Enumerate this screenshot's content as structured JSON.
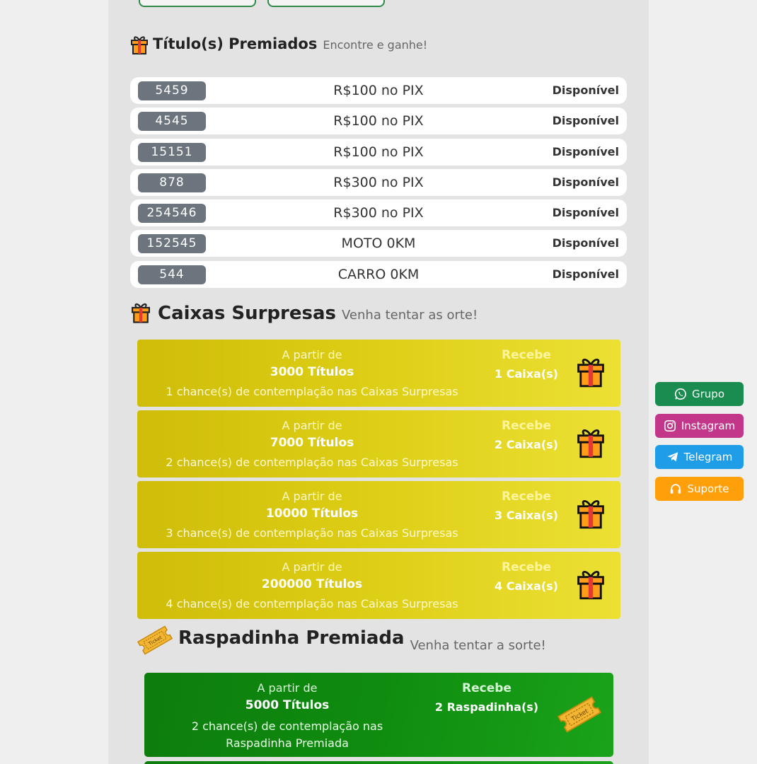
{
  "premiados": {
    "title": "Título(s) Premiados",
    "subtitle": "Encontre e ganhe!",
    "rows": [
      {
        "number": "5459",
        "prize": "R$100 no PIX",
        "status": "Disponível"
      },
      {
        "number": "4545",
        "prize": "R$100 no PIX",
        "status": "Disponível"
      },
      {
        "number": "15151",
        "prize": "R$100 no PIX",
        "status": "Disponível"
      },
      {
        "number": "878",
        "prize": "R$300 no PIX",
        "status": "Disponível"
      },
      {
        "number": "254546",
        "prize": "R$300 no PIX",
        "status": "Disponível"
      },
      {
        "number": "152545",
        "prize": "MOTO 0KM",
        "status": "Disponível"
      },
      {
        "number": "544",
        "prize": "CARRO 0KM",
        "status": "Disponível"
      }
    ]
  },
  "caixas": {
    "title": "Caixas Surpresas",
    "subtitle": "Venha tentar as orte!",
    "cards": [
      {
        "from_label": "A partir de",
        "titles": "3000 Títulos",
        "chances": "1 chance(s) de contemplação nas Caixas Surpresas",
        "receive_label": "Recebe",
        "reward": "1 Caixa(s)"
      },
      {
        "from_label": "A partir de",
        "titles": "7000 Títulos",
        "chances": "2 chance(s) de contemplação nas Caixas Surpresas",
        "receive_label": "Recebe",
        "reward": "2 Caixa(s)"
      },
      {
        "from_label": "A partir de",
        "titles": "10000 Títulos",
        "chances": "3 chance(s) de contemplação nas Caixas Surpresas",
        "receive_label": "Recebe",
        "reward": "3 Caixa(s)"
      },
      {
        "from_label": "A partir de",
        "titles": "200000 Títulos",
        "chances": "4 chance(s) de contemplação nas Caixas Surpresas",
        "receive_label": "Recebe",
        "reward": "4 Caixa(s)"
      }
    ]
  },
  "raspadinha": {
    "title": "Raspadinha Premiada",
    "subtitle": "Venha tentar a sorte!",
    "ticket_text": "Ticket",
    "cards": [
      {
        "from_label": "A partir de",
        "titles": "5000 Títulos",
        "chances_line1": "2 chance(s) de contemplação nas",
        "chances_line2": "Raspadinha Premiada",
        "receive_label": "Recebe",
        "reward": "2 Raspadinha(s)"
      }
    ]
  },
  "side_buttons": {
    "grupo": "Grupo",
    "instagram": "Instagram",
    "telegram": "Telegram",
    "suporte": "Suporte"
  },
  "colors": {
    "grupo": "#1a8c4f",
    "instagram": "#c2378a",
    "telegram": "#1f9de6",
    "suporte": "#ff9f0a"
  }
}
